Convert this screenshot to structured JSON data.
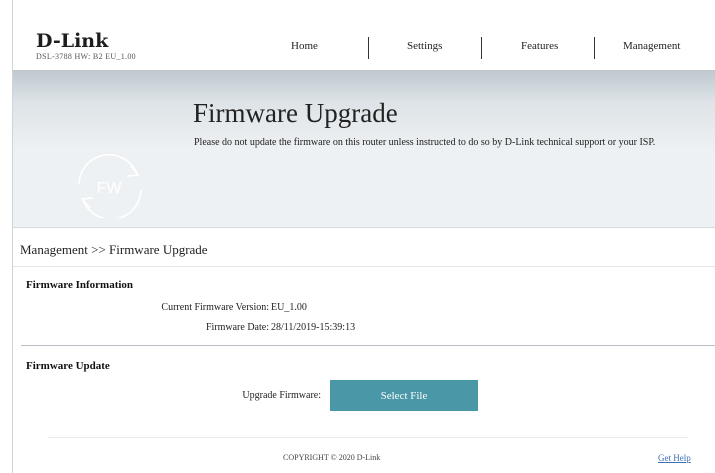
{
  "header": {
    "logo": "D-Link",
    "device_info": "DSL-3788  HW: B2  EU_1.00",
    "nav": [
      "Home",
      "Settings",
      "Features",
      "Management"
    ]
  },
  "banner": {
    "title": "Firmware Upgrade",
    "description": "Please do not update the firmware on this router unless instructed to do so by D-Link technical support or your ISP.",
    "icon_text": "FW"
  },
  "breadcrumb": "Management >> Firmware Upgrade",
  "firmware_information": {
    "title": "Firmware Information",
    "current_version_label": "Current Firmware Version:",
    "current_version_value": "EU_1.00",
    "date_label": "Firmware Date:",
    "date_value": "28/11/2019-15:39:13"
  },
  "firmware_update": {
    "title": "Firmware Update",
    "upgrade_label": "Upgrade Firmware:",
    "select_button": "Select File"
  },
  "footer": {
    "copyright": "COPYRIGHT © 2020 D-Link",
    "help": "Get Help"
  },
  "colors": {
    "accent": "#4a97a8",
    "link": "#3a6fb0"
  }
}
